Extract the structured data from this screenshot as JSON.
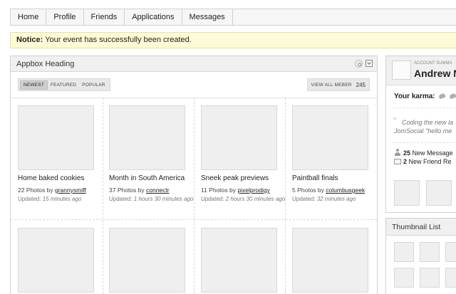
{
  "nav": {
    "items": [
      "Home",
      "Profile",
      "Friends",
      "Applications",
      "Messages"
    ]
  },
  "notice": {
    "label": "Notice:",
    "text": " Your event has successfully been created."
  },
  "appbox": {
    "heading": "Appbox Heading",
    "filters": [
      "Newest",
      "Featured",
      "Popular"
    ],
    "view_all": "View all meber",
    "count": "245",
    "cards": [
      {
        "title": "Home baked cookies",
        "photos": "22 Photos by ",
        "user": "grannysmiff",
        "updated_label": "Updated: ",
        "updated": "15 minutes ago"
      },
      {
        "title": "Month in South America",
        "photos": "37 Photos by ",
        "user": "connectr",
        "updated_label": "Updated: ",
        "updated": "1 hours 30 minutes ago"
      },
      {
        "title": "Sneek peak previews",
        "photos": "11 Photos by ",
        "user": "pixelprodigy",
        "updated_label": "Updated: ",
        "updated": "2 hours 30 minutes ago"
      },
      {
        "title": "Paintball finals",
        "photos": "5 Photos by ",
        "user": "columbusgeek",
        "updated_label": "Updated: ",
        "updated": "32 minutes ago"
      }
    ]
  },
  "account": {
    "summary_label": "Account Summa",
    "name": "Andrew N",
    "karma_label": "Your karma:",
    "quote_mark": "\"",
    "quote_line1": "Coding the new la",
    "quote_line2": "JomSocial \"hello me",
    "messages_count": "25",
    "messages_text": " New Message",
    "friends_count": "2",
    "friends_text": " New Friend Re"
  },
  "thumbnail_list": {
    "heading": "Thumbnail List"
  }
}
